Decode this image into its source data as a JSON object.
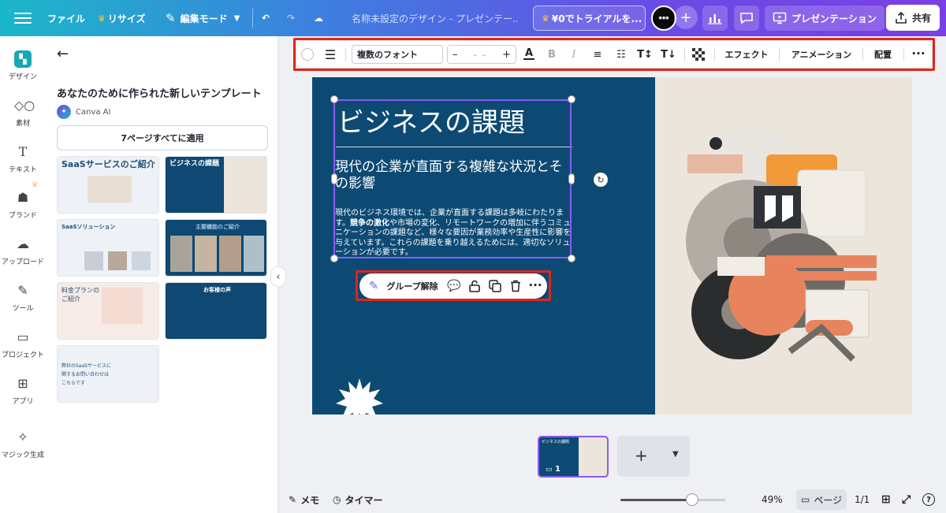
{
  "topbar": {
    "file": "ファイル",
    "resize": "リサイズ",
    "edit_mode": "編集モード",
    "doc_title": "名称未設定のデザイン - プレゼンテー...",
    "trial": "¥0でトライアルを...",
    "present": "プレゼンテーション",
    "share": "共有"
  },
  "rail": [
    {
      "label": "デザイン",
      "icon": "design-icon"
    },
    {
      "label": "素材",
      "icon": "elements-icon"
    },
    {
      "label": "テキスト",
      "icon": "text-icon"
    },
    {
      "label": "ブランド",
      "icon": "brand-icon"
    },
    {
      "label": "アップロード",
      "icon": "upload-icon"
    },
    {
      "label": "ツール",
      "icon": "tools-icon"
    },
    {
      "label": "プロジェクト",
      "icon": "folder-icon"
    },
    {
      "label": "アプリ",
      "icon": "apps-icon"
    },
    {
      "label": "マジック生成",
      "icon": "magic-icon"
    }
  ],
  "panel": {
    "title": "あなたのために作られた新しいテンプレート",
    "ai_label": "Canva AI",
    "apply_all": "7ページすべてに適用",
    "templates": [
      {
        "title": "SaaSサービスのご紹介",
        "style": "light"
      },
      {
        "title": "ビジネスの課題",
        "style": "dark"
      },
      {
        "title": "SaaSソリューション",
        "style": "light"
      },
      {
        "title": "主要機能のご紹介",
        "style": "dark"
      },
      {
        "title": "料金プランのご紹介",
        "style": "pink"
      },
      {
        "title": "お客様の声",
        "style": "dark"
      },
      {
        "title": "弊社のSaaSサービスに関するお問い合わせはこちらです",
        "style": "light"
      }
    ]
  },
  "text_toolbar": {
    "font": "複数のフォント",
    "size_minus": "–",
    "size_value": "– –",
    "size_plus": "+",
    "effects": "エフェクト",
    "animation": "アニメーション",
    "position": "配置",
    "more": "•••"
  },
  "slide": {
    "title": "ビジネスの課題",
    "subtitle": "現代の企業が直面する複雑な状況とその影響",
    "body_pre": "現代のビジネス環境では、企業が直面する課題は多岐にわたります。",
    "body_bold": "競争の激化",
    "body_post": "や市場の変化、リモートワークの増加に伴うコミュニケーションの課題など、様々な要因が業務効率や生産性に影響を与えています。これらの課題を乗り越えるためには、適切なソリューションが必要です。"
  },
  "group_toolbar": {
    "ungroup": "グループ解除",
    "more": "•••"
  },
  "pages": {
    "thumb_title": "ビジネスの課題",
    "page_number": "1"
  },
  "bottombar": {
    "notes": "メモ",
    "timer": "タイマー",
    "zoom": "49%",
    "zoom_fraction": 0.49,
    "pages": "ページ",
    "page_count": "1/1"
  },
  "colors": {
    "slide_blue": "#0d4a73",
    "selection": "#8b5cf6",
    "highlight": "#e0251b",
    "accent_orange": "#f29a3a"
  }
}
